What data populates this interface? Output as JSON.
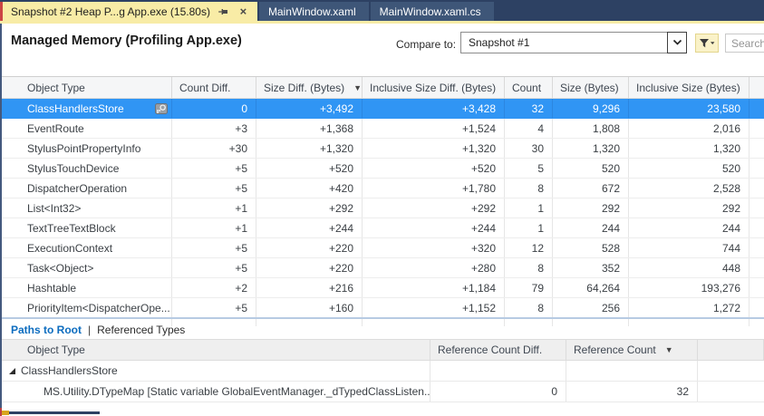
{
  "tab_bar": {
    "active_tab": {
      "label": "Snapshot #2 Heap P...g App.exe (15.80s)"
    },
    "tabs": [
      {
        "label": "MainWindow.xaml"
      },
      {
        "label": "MainWindow.xaml.cs"
      }
    ]
  },
  "header": {
    "title": "Managed Memory (Profiling App.exe)",
    "compare_label": "Compare to:",
    "compare_value": "Snapshot #1",
    "search_placeholder": "Search"
  },
  "main_table": {
    "columns": [
      "Object Type",
      "Count Diff.",
      "Size Diff. (Bytes)",
      "Inclusive Size Diff. (Bytes)",
      "Count",
      "Size (Bytes)",
      "Inclusive Size (Bytes)"
    ],
    "sorted_column": "Size Diff. (Bytes)",
    "sort_direction": "desc",
    "rows": [
      {
        "object_type": "ClassHandlersStore",
        "count_diff": "0",
        "size_diff": "+3,492",
        "inclusive_size_diff": "+3,428",
        "count": "32",
        "size": "9,296",
        "inclusive_size": "23,580",
        "selected": true
      },
      {
        "object_type": "EventRoute",
        "count_diff": "+3",
        "size_diff": "+1,368",
        "inclusive_size_diff": "+1,524",
        "count": "4",
        "size": "1,808",
        "inclusive_size": "2,016",
        "selected": false
      },
      {
        "object_type": "StylusPointPropertyInfo",
        "count_diff": "+30",
        "size_diff": "+1,320",
        "inclusive_size_diff": "+1,320",
        "count": "30",
        "size": "1,320",
        "inclusive_size": "1,320",
        "selected": false
      },
      {
        "object_type": "StylusTouchDevice",
        "count_diff": "+5",
        "size_diff": "+520",
        "inclusive_size_diff": "+520",
        "count": "5",
        "size": "520",
        "inclusive_size": "520",
        "selected": false
      },
      {
        "object_type": "DispatcherOperation",
        "count_diff": "+5",
        "size_diff": "+420",
        "inclusive_size_diff": "+1,780",
        "count": "8",
        "size": "672",
        "inclusive_size": "2,528",
        "selected": false
      },
      {
        "object_type": "List<Int32>",
        "count_diff": "+1",
        "size_diff": "+292",
        "inclusive_size_diff": "+292",
        "count": "1",
        "size": "292",
        "inclusive_size": "292",
        "selected": false
      },
      {
        "object_type": "TextTreeTextBlock",
        "count_diff": "+1",
        "size_diff": "+244",
        "inclusive_size_diff": "+244",
        "count": "1",
        "size": "244",
        "inclusive_size": "244",
        "selected": false
      },
      {
        "object_type": "ExecutionContext",
        "count_diff": "+5",
        "size_diff": "+220",
        "inclusive_size_diff": "+320",
        "count": "12",
        "size": "528",
        "inclusive_size": "744",
        "selected": false
      },
      {
        "object_type": "Task<Object>",
        "count_diff": "+5",
        "size_diff": "+220",
        "inclusive_size_diff": "+280",
        "count": "8",
        "size": "352",
        "inclusive_size": "448",
        "selected": false
      },
      {
        "object_type": "Hashtable",
        "count_diff": "+2",
        "size_diff": "+216",
        "inclusive_size_diff": "+1,184",
        "count": "79",
        "size": "64,264",
        "inclusive_size": "193,276",
        "selected": false
      },
      {
        "object_type": "PriorityItem<DispatcherOpe...",
        "count_diff": "+5",
        "size_diff": "+160",
        "inclusive_size_diff": "+1,152",
        "count": "8",
        "size": "256",
        "inclusive_size": "1,272",
        "selected": false
      }
    ]
  },
  "bottom_panel": {
    "view_tabs": [
      {
        "label": "Paths to Root",
        "active": true
      },
      {
        "label": "Referenced Types",
        "active": false
      }
    ],
    "separator": "|",
    "columns": [
      "Object Type",
      "Reference Count Diff.",
      "Reference Count"
    ],
    "sorted_column": "Reference Count",
    "sort_direction": "desc",
    "rows": [
      {
        "object_type": "ClassHandlersStore",
        "reference_count_diff": "",
        "reference_count": "",
        "level": 0,
        "expanded": true
      },
      {
        "object_type": "MS.Utility.DTypeMap [Static variable GlobalEventManager._dTypedClassListen...",
        "reference_count_diff": "0",
        "reference_count": "32",
        "level": 1,
        "expanded": null
      }
    ]
  },
  "colors": {
    "selection_blue": "#3095f4",
    "active_tab_yellow": "#f8eca6",
    "tab_bar_navy": "#2d4163",
    "inactive_tab_navy": "#3e5678",
    "link_blue": "#0c6cbf"
  }
}
